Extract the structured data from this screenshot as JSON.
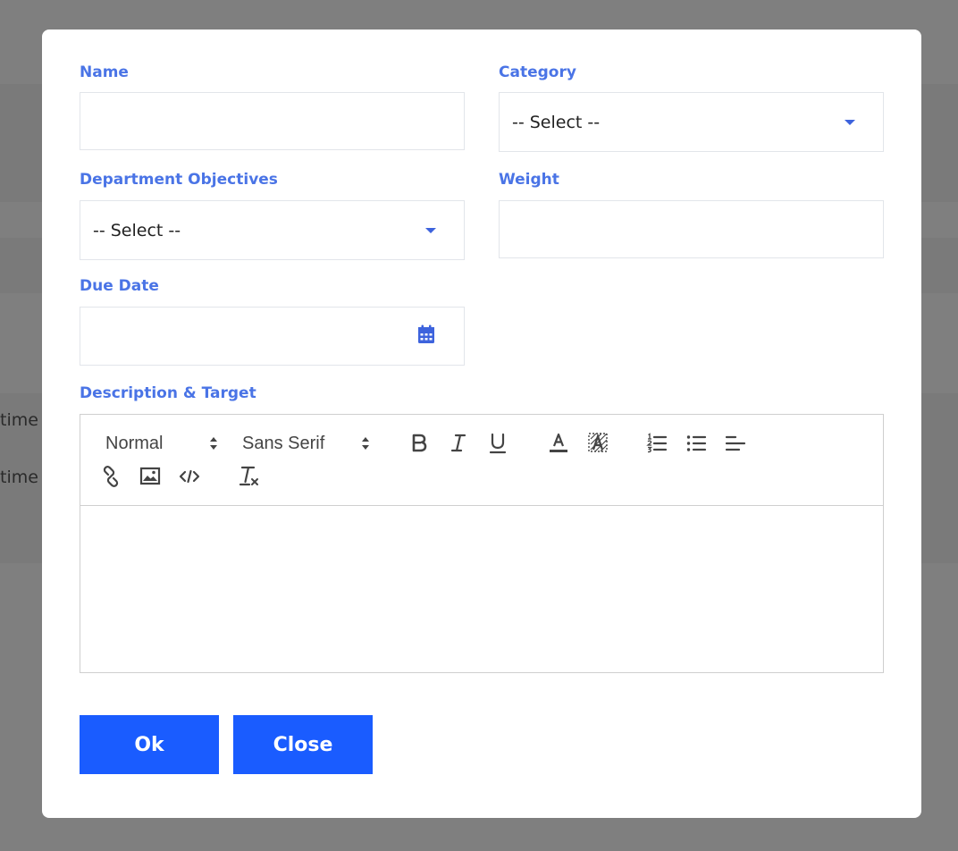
{
  "background": {
    "partial_texts": [
      "time",
      "time"
    ]
  },
  "modal": {
    "fields": {
      "name": {
        "label": "Name",
        "value": ""
      },
      "category": {
        "label": "Category",
        "selected": "-- Select --"
      },
      "department_objectives": {
        "label": "Department Objectives",
        "selected": "-- Select --"
      },
      "weight": {
        "label": "Weight",
        "value": ""
      },
      "due_date": {
        "label": "Due Date",
        "value": ""
      },
      "description": {
        "label": "Description & Target"
      }
    },
    "editor": {
      "header_picker": "Normal",
      "font_picker": "Sans Serif",
      "toolbar_icons": [
        "bold-icon",
        "italic-icon",
        "underline-icon",
        "text-color-icon",
        "background-color-icon",
        "ordered-list-icon",
        "bullet-list-icon",
        "align-left-icon",
        "link-icon",
        "image-icon",
        "code-icon",
        "clear-format-icon"
      ],
      "content": ""
    },
    "buttons": {
      "ok": "Ok",
      "close": "Close"
    }
  },
  "colors": {
    "label": "#4a74e6",
    "primary_button": "#1a5cff",
    "overlay": "#7f7f7f"
  }
}
